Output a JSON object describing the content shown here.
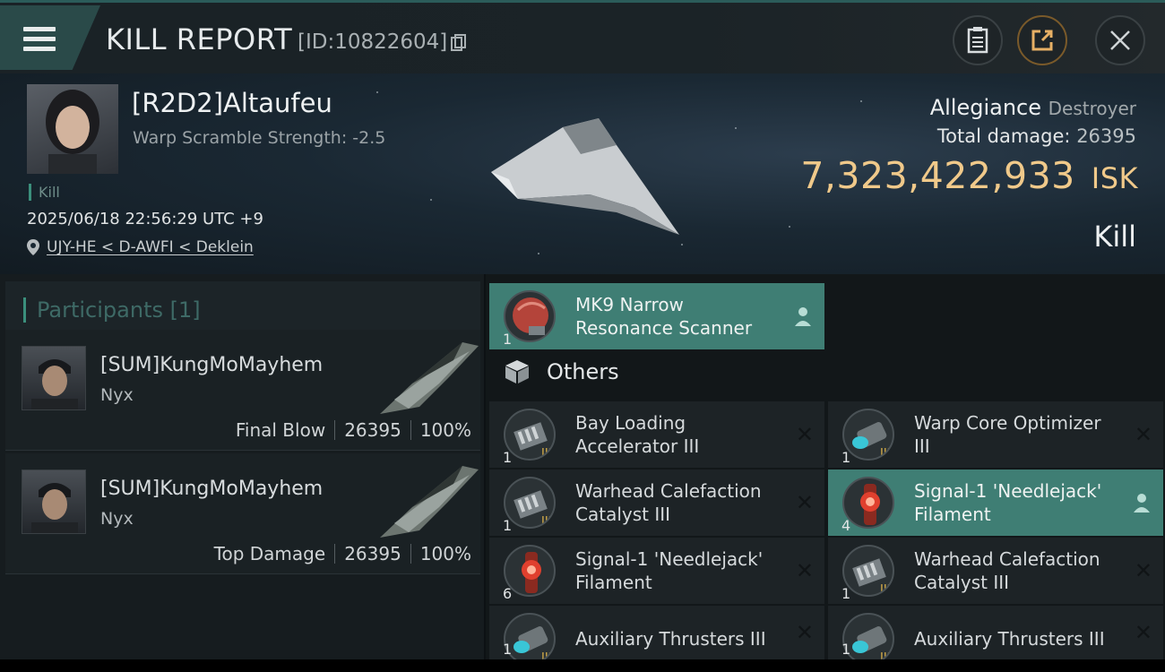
{
  "header": {
    "title": "KILL REPORT",
    "report_id": "[ID:10822604]"
  },
  "victim": {
    "name": "[R2D2]Altaufeu",
    "warp_scramble": "Warp Scramble Strength: -2.5",
    "status_tag": "Kill",
    "datetime": "2025/06/18 22:56:29 UTC +9",
    "location": "UJY-HE < D-AWFI < Deklein",
    "ship_name": "Allegiance",
    "ship_class": "Destroyer",
    "total_damage_label": "Total damage:",
    "total_damage": "26395",
    "isk_value": "7,323,422,933",
    "isk_unit": "ISK",
    "kill_label": "Kill"
  },
  "participants": {
    "title": "Participants",
    "count": "[1]",
    "rows": [
      {
        "name": "[SUM]KungMoMayhem",
        "ship": "Nyx",
        "role": "Final Blow",
        "damage": "26395",
        "percent": "100%"
      },
      {
        "name": "[SUM]KungMoMayhem",
        "ship": "Nyx",
        "role": "Top Damage",
        "damage": "26395",
        "percent": "100%"
      }
    ]
  },
  "items": {
    "top_item": {
      "qty": "1",
      "line1": "MK9 Narrow",
      "line2": "Resonance Scanner"
    },
    "others_label": "Others",
    "list": [
      {
        "qty": "1",
        "line1": "Bay Loading",
        "line2": "Accelerator III",
        "icon": "module-icon"
      },
      {
        "qty": "1",
        "line1": "Warp Core Optimizer",
        "line2": "III",
        "icon": "thruster-icon"
      },
      {
        "qty": "1",
        "line1": "Warhead Calefaction",
        "line2": "Catalyst III",
        "icon": "module-icon"
      },
      {
        "qty": "4",
        "line1": "Signal-1 'Needlejack'",
        "line2": "Filament",
        "icon": "filament-icon"
      },
      {
        "qty": "6",
        "line1": "Signal-1 'Needlejack'",
        "line2": "Filament",
        "icon": "filament-icon"
      },
      {
        "qty": "1",
        "line1": "Warhead Calefaction",
        "line2": "Catalyst III",
        "icon": "module-icon"
      },
      {
        "qty": "1",
        "line1": "Auxiliary Thrusters III",
        "line2": "",
        "icon": "thruster-icon"
      },
      {
        "qty": "1",
        "line1": "Auxiliary Thrusters III",
        "line2": "",
        "icon": "thruster-icon"
      }
    ]
  },
  "colors": {
    "accent": "#3f7e74",
    "isk": "#f0c98a",
    "panel": "#1d2326"
  }
}
